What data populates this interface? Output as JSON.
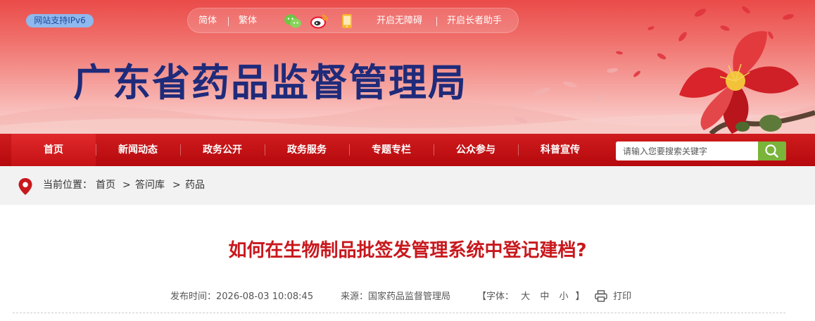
{
  "header": {
    "ipv6_badge": "网站支持IPv6",
    "lang_simplified": "简体",
    "lang_traditional": "繁体",
    "accessibility": "开启无障碍",
    "elder_helper": "开启长者助手",
    "site_title": "广东省药品监督管理局",
    "icons": [
      "wechat-icon",
      "weibo-icon",
      "mobile-icon"
    ]
  },
  "nav": {
    "items": [
      "首页",
      "新闻动态",
      "政务公开",
      "政务服务",
      "专题专栏",
      "公众参与",
      "科普宣传"
    ],
    "search_placeholder": "请输入您要搜索关键字"
  },
  "breadcrumb": {
    "prefix": "当前位置：",
    "home": "首页",
    "sep": ">",
    "level1": "答问库",
    "level2": "药品"
  },
  "article": {
    "title": "如何在生物制品批签发管理系统中登记建档?",
    "publish_label": "发布时间：",
    "publish_time": "2026-08-03 10:08:45",
    "source_label": "来源：",
    "source": "国家药品监督管理局",
    "font_label": "【字体：",
    "font_large": "大",
    "font_medium": "中",
    "font_small": "小",
    "font_close": "】",
    "print_label": "打印"
  },
  "colors": {
    "nav_red": "#c51215",
    "title_red": "#c8181d",
    "site_title_blue": "#1f2b7a",
    "search_green": "#7ab43a"
  }
}
